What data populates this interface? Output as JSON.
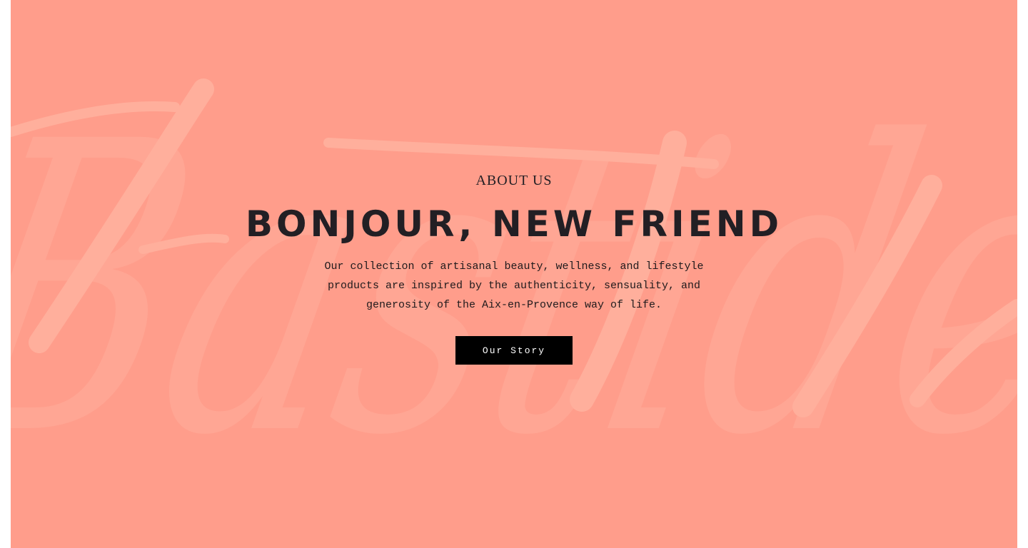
{
  "colors": {
    "hero_background": "#ff9d8b",
    "watermark": "#ffaf9c",
    "text_dark": "#221f24",
    "button_background": "#000000",
    "button_text": "#ffffff"
  },
  "hero": {
    "eyebrow": "ABOUT US",
    "headline": "BONJOUR, NEW FRIEND",
    "body": "Our collection of artisanal beauty, wellness, and lifestyle products are inspired by the authenticity, sensuality, and generosity of the Aix-en-Provence way of life.",
    "cta_label": "Our Story",
    "watermark_text": "Bastide"
  }
}
